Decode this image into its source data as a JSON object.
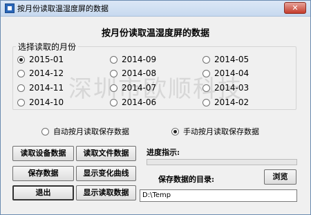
{
  "window": {
    "title": "按月份读取温湿度屏的数据",
    "close_label": "✕"
  },
  "heading": "按月份读取温湿度屏的数据",
  "month_group": {
    "label": "选择读取的月份",
    "months": [
      "2015-01",
      "2014-12",
      "2014-11",
      "2014-10",
      "2014-09",
      "2014-08",
      "2014-07",
      "2014-06",
      "2014-05",
      "2014-04",
      "2014-03",
      "2014-02"
    ],
    "selected": "2015-01"
  },
  "watermark": "深圳市欧顺科技",
  "mode": {
    "auto_label": "自动按月读取保存数据",
    "manual_label": "手动按月读取保存数据",
    "selected": "manual"
  },
  "buttons": {
    "read_device": "读取设备数据",
    "read_file": "读取文件数据",
    "save": "保存数据",
    "show_curve": "显示变化曲线",
    "exit": "退出",
    "show_read": "显示读取数据",
    "browse": "浏览"
  },
  "progress": {
    "label": "进度指示:",
    "value": 0
  },
  "save_dir": {
    "label": "保存数据的目录:",
    "value": "D:\\Temp"
  }
}
